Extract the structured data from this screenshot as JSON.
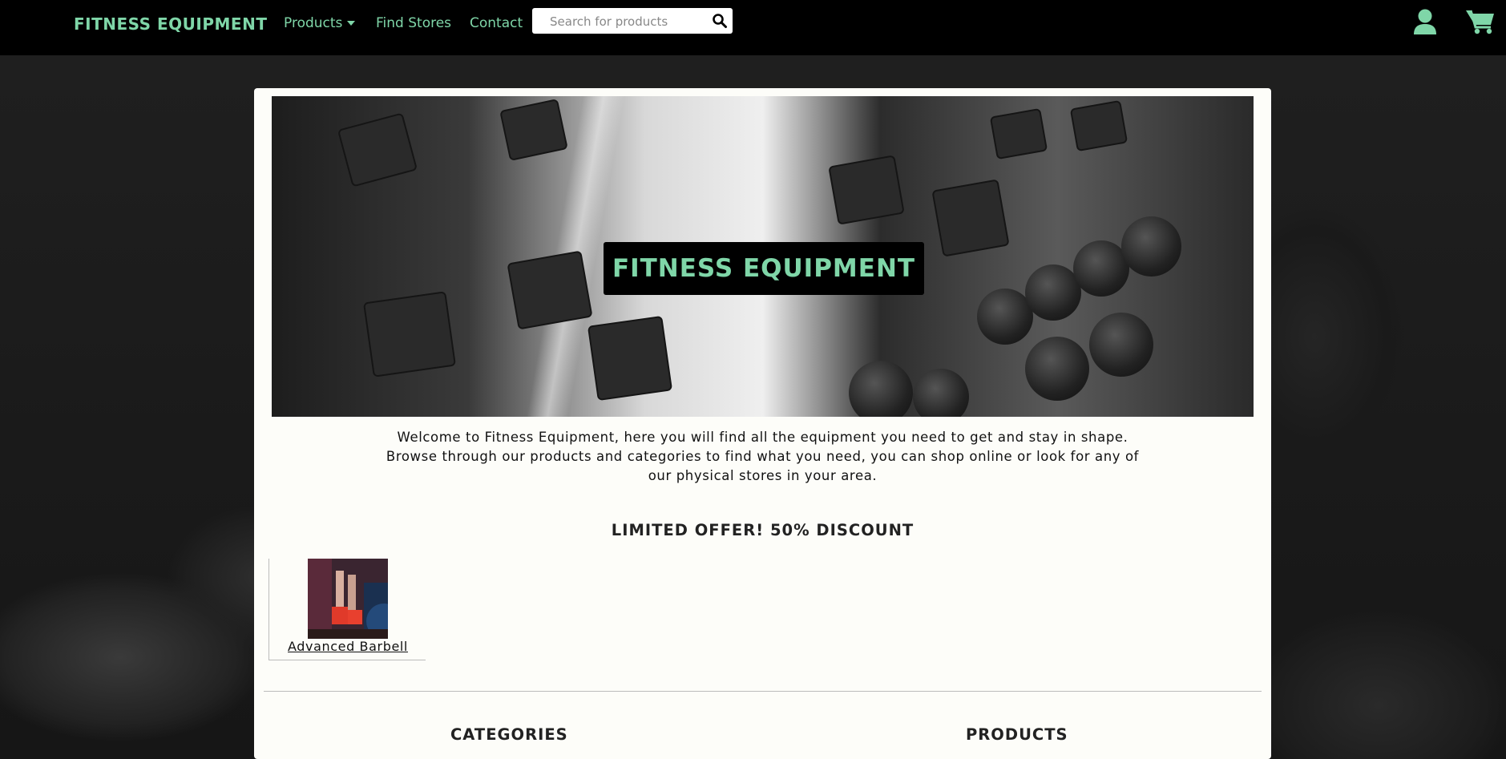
{
  "navbar": {
    "brand": "FITNESS EQUIPMENT",
    "links": [
      {
        "label": "Products"
      },
      {
        "label": "Find Stores"
      },
      {
        "label": "Contact"
      }
    ],
    "search_placeholder": "Search for products",
    "icons": [
      "search-icon",
      "user-icon",
      "cart-icon"
    ]
  },
  "hero": {
    "title": "FITNESS EQUIPMENT"
  },
  "welcome": {
    "line1": "Welcome to Fitness Equipment, here you will find all the equipment you need to get and stay in shape.",
    "line2": "Browse through our products and categories to find what you need, you can shop online or look for any of",
    "line3": "our physical stores in your area."
  },
  "offer": {
    "title": "LIMITED OFFER! 50% DISCOUNT",
    "products": [
      {
        "name": "Advanced Barbell"
      }
    ]
  },
  "sections": {
    "categories": "CATEGORIES",
    "products": "PRODUCTS"
  },
  "colors": {
    "accent": "#7fd6a8",
    "navbar": "#000000",
    "card": "#fdfdf9"
  }
}
